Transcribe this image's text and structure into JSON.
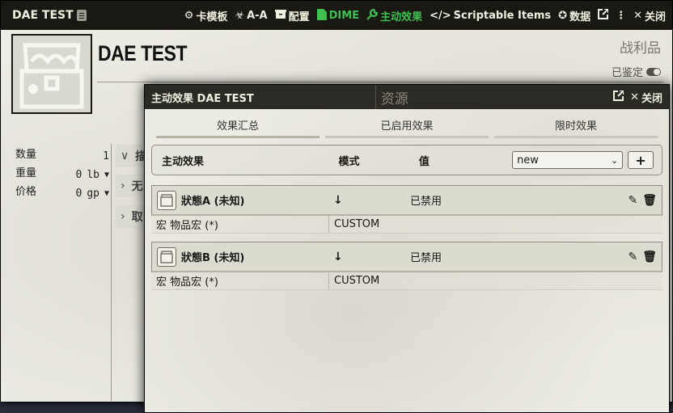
{
  "sheet": {
    "title": "DAE TEST",
    "actions": [
      {
        "label": "卡模板",
        "icon": "gear-icon"
      },
      {
        "label": "A-A",
        "icon": "biohazard-icon"
      },
      {
        "label": "配置",
        "icon": "box-icon"
      },
      {
        "label": "DIME",
        "icon": "file-icon"
      },
      {
        "label": "主动效果",
        "icon": "wrench-icon"
      },
      {
        "label": "Scriptable Items",
        "icon": "code-icon"
      },
      {
        "label": "数据",
        "icon": "cog-icon"
      },
      {
        "label": "",
        "icon": "external-link-icon"
      },
      {
        "label": "",
        "icon": "more-icon"
      },
      {
        "label": "关闭",
        "icon": "close-icon"
      }
    ],
    "item_name": "DAE TEST",
    "item_type": "战利品",
    "identified_label": "已鉴定",
    "properties": [
      {
        "label": "数量",
        "value": "1",
        "unit": ""
      },
      {
        "label": "重量",
        "value": "0",
        "unit": "lb"
      },
      {
        "label": "价格",
        "value": "0",
        "unit": "gp"
      }
    ],
    "side_sections": [
      "描",
      "无",
      "取"
    ],
    "tab_hint": "资源"
  },
  "dialog": {
    "title": "主动效果 DAE TEST",
    "close_label": "关闭",
    "tabs": [
      "效果汇总",
      "已启用效果",
      "限时效果"
    ],
    "header": {
      "name_col": "主动效果",
      "mode_col": "模式",
      "value_col": "值",
      "select_value": "new",
      "add_label": "+"
    },
    "effects": [
      {
        "name": "狀態A (未知)",
        "status": "已禁用",
        "change_key": "宏 物品宏 (*)",
        "change_mode": "CUSTOM"
      },
      {
        "name": "狀態B (未知)",
        "status": "已禁用",
        "change_key": "宏 物品宏 (*)",
        "change_mode": "CUSTOM"
      }
    ]
  },
  "colors": {
    "header_bg": "#191813",
    "parchment": "#ecebe4",
    "accent_green": "#3fbf4f"
  }
}
